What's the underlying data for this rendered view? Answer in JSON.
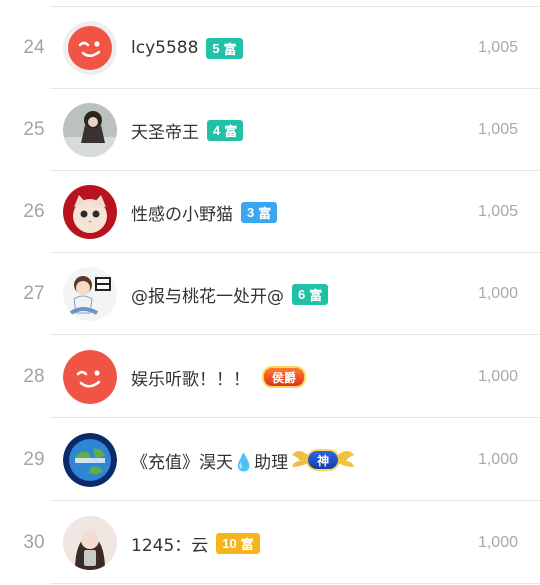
{
  "accent": {
    "teal": "#21c1a8",
    "blue": "#3aa6f0",
    "gold": "#f6b51c",
    "red": "#f05444"
  },
  "rows": [
    {
      "rank": "24",
      "name": "lcy5588",
      "badge_level": "5",
      "badge_text": "富",
      "badge_type": "teal",
      "score": "1,005",
      "avatar": "default-avatar"
    },
    {
      "rank": "25",
      "name": "天圣帝王",
      "badge_level": "4",
      "badge_text": "富",
      "badge_type": "teal",
      "score": "1,005",
      "avatar": "photo-avatar"
    },
    {
      "rank": "26",
      "name": "性感の小野猫",
      "badge_level": "3",
      "badge_text": "富",
      "badge_type": "blue",
      "score": "1,005",
      "avatar": "kitten-avatar"
    },
    {
      "rank": "27",
      "name": "@报与桃花一处开@",
      "badge_level": "6",
      "badge_text": "富",
      "badge_type": "teal",
      "score": "1,000",
      "avatar": "cartoon-avatar"
    },
    {
      "rank": "28",
      "name": "娱乐听歌！！！",
      "badge_level": "",
      "badge_text": "侯爵",
      "badge_type": "noble",
      "score": "1,000",
      "avatar": "default-avatar"
    },
    {
      "rank": "29",
      "name": "《充值》淏天💧助理",
      "badge_level": "",
      "badge_text": "神",
      "badge_type": "god",
      "score": "1,000",
      "avatar": "earth-avatar"
    },
    {
      "rank": "30",
      "name": "1245：云",
      "badge_level": "10",
      "badge_text": "富",
      "badge_type": "gold",
      "score": "1,000",
      "avatar": "photo-avatar"
    }
  ]
}
